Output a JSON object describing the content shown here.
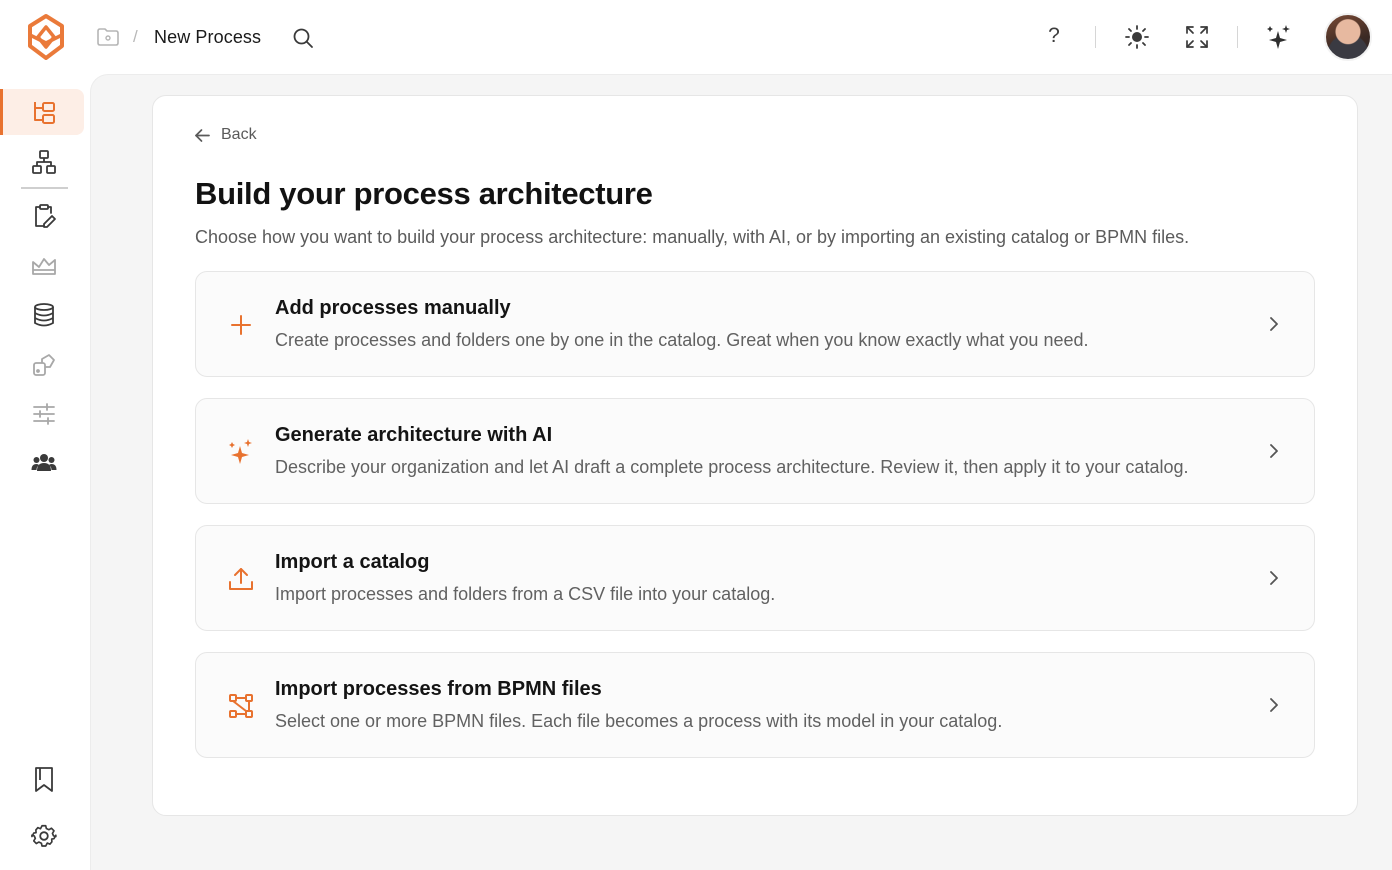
{
  "topbar": {
    "page_title": "New Process",
    "separator": "/",
    "help_label": "?",
    "icons": [
      "app-logo-icon",
      "folder-icon",
      "search-icon",
      "help-icon",
      "sun-icon",
      "expand-icon",
      "sparkle-icon",
      "avatar"
    ]
  },
  "sidebar": {
    "items": [
      {
        "name": "catalog-tree-icon",
        "active": true
      },
      {
        "name": "org-chart-icon",
        "active": false
      },
      {
        "name": "clipboard-edit-icon",
        "active": false
      },
      {
        "name": "landscape-icon",
        "active": false
      },
      {
        "name": "database-icon",
        "active": false
      },
      {
        "name": "integrations-icon",
        "active": false
      },
      {
        "name": "sliders-icon",
        "active": false
      },
      {
        "name": "users-icon",
        "active": false
      }
    ],
    "bottom": [
      "bookmark-icon",
      "settings-icon"
    ]
  },
  "main": {
    "back_label": "Back",
    "title": "Build your process architecture",
    "subtitle": "Choose how you want to build your process architecture: manually, with AI, or by importing an existing catalog or BPMN files.",
    "options": [
      {
        "icon": "plus-icon",
        "title": "Add processes manually",
        "description": "Create processes and folders one by one in the catalog. Great when you know exactly what you need."
      },
      {
        "icon": "sparkle-icon",
        "title": "Generate architecture with AI",
        "description": "Describe your organization and let AI draft a complete process architecture. Review it, then apply it to your catalog."
      },
      {
        "icon": "upload-icon",
        "title": "Import a catalog",
        "description": "Import processes and folders from a CSV file into your catalog."
      },
      {
        "icon": "bpmn-icon",
        "title": "Import processes from BPMN files",
        "description": "Select one or more BPMN files. Each file becomes a process with its model in your catalog."
      }
    ]
  },
  "colors": {
    "accent": "#e8722f",
    "active_bg": "#fdeee6",
    "page_bg": "#f5f5f5",
    "card_bg": "#ffffff",
    "option_bg": "#fbfbfb"
  }
}
